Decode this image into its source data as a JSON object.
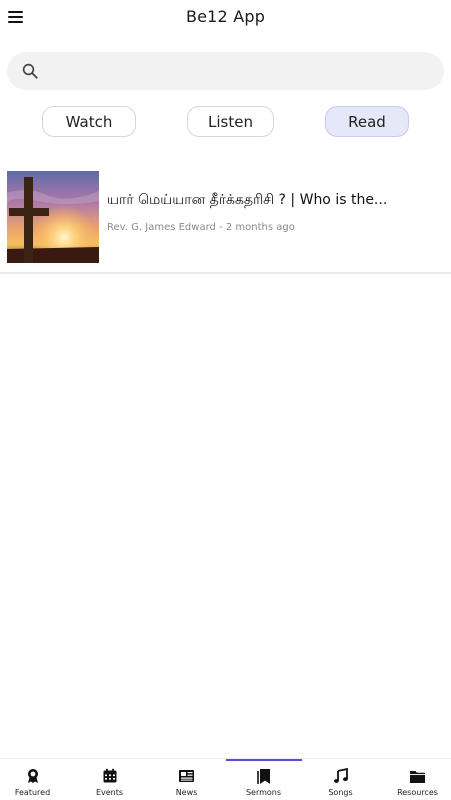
{
  "header": {
    "title": "Be12 App"
  },
  "search": {
    "placeholder": "",
    "value": ""
  },
  "filters": {
    "watch": "Watch",
    "listen": "Listen",
    "read": "Read",
    "selected": "Read"
  },
  "sermons": [
    {
      "title": "யார் மெய்யான தீர்க்கதரிசி ? | Who is the...",
      "meta": "Rev. G. James Edward - 2 months ago"
    }
  ],
  "bottom_nav": {
    "featured": "Featured",
    "events": "Events",
    "news": "News",
    "sermons": "Sermons",
    "songs": "Songs",
    "resources": "Resources",
    "active": "Sermons"
  },
  "colors": {
    "accent": "#5b4bdb",
    "selected_pill": "#e6e7f8",
    "search_bg": "#f2f2f2"
  }
}
